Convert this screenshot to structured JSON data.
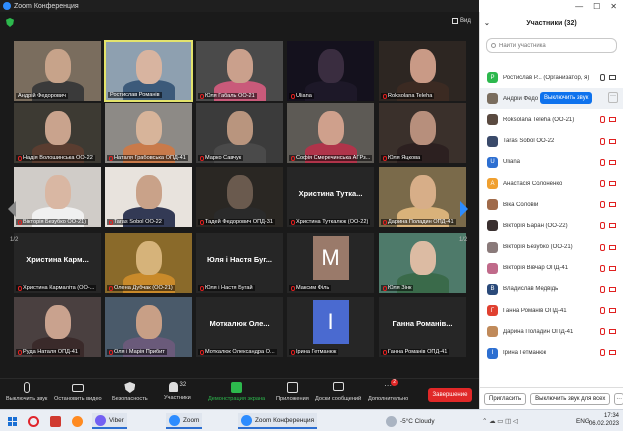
{
  "window": {
    "title": "Zoom Конференция",
    "minimize_glyph": "—",
    "maximize_glyph": "☐",
    "close_glyph": "✕"
  },
  "meeting": {
    "view_label": "Вид",
    "page_left": "1/2",
    "page_right": "1/2",
    "tiles": [
      {
        "name": "Андрій Федорович",
        "mic_off": false,
        "kind": "video",
        "face": "#c7a38a",
        "shirt": "#3a3a3a",
        "bg": "#7a6d5e"
      },
      {
        "name": "Ростислав Романів",
        "mic_off": false,
        "kind": "video",
        "face": "#d8b4a0",
        "shirt": "#3c5a7a",
        "bg": "#8ea0b0",
        "active": true
      },
      {
        "name": "Юля Габаль ОО-21",
        "mic_off": true,
        "kind": "video",
        "face": "#caa08c",
        "shirt": "#c95a7a",
        "bg": "#4a4a4a"
      },
      {
        "name": "Uliana",
        "mic_off": true,
        "kind": "video",
        "face": "#3a2d40",
        "shirt": "#1d1828",
        "bg": "#14111d"
      },
      {
        "name": "Roksolana Teleha",
        "mic_off": true,
        "kind": "video",
        "face": "#c99a86",
        "shirt": "#3b2a22",
        "bg": "#2d2622"
      },
      {
        "name": "Надія Волошинська ОО-22",
        "mic_off": true,
        "kind": "video",
        "face": "#c9a38d",
        "shirt": "#5a3d30",
        "bg": "#3d3a33"
      },
      {
        "name": "Наталя Грабовська ОПД-41",
        "mic_off": true,
        "kind": "video",
        "face": "#d7b49a",
        "shirt": "#c97a4a",
        "bg": "#8d8a86"
      },
      {
        "name": "Марко Савчук",
        "mic_off": true,
        "kind": "video",
        "face": "#b9957e",
        "shirt": "#4a4a4a",
        "bg": "#3b3b3b"
      },
      {
        "name": "Софія Смеречинська АГРз...",
        "mic_off": true,
        "kind": "video",
        "face": "#cfa08c",
        "shirt": "#b0344a",
        "bg": "#5d5a55"
      },
      {
        "name": "Юля Яцкова",
        "mic_off": true,
        "kind": "video",
        "face": "#b78f7c",
        "shirt": "#2c2020",
        "bg": "#3a302b"
      },
      {
        "name": "Вікторія Безубко ОО-21)",
        "mic_off": true,
        "kind": "video",
        "face": "#d9b7a3",
        "shirt": "#f0f0f0",
        "bg": "#d0ccc8"
      },
      {
        "name": "Taras Sobol OO-22",
        "mic_off": true,
        "kind": "video",
        "face": "#c9a289",
        "shirt": "#333a55",
        "bg": "#e8e3dd"
      },
      {
        "name": "Тадей Федорович ОПД-31",
        "mic_off": true,
        "kind": "video",
        "face": "#6a5a4e",
        "shirt": "#2a2a2a",
        "bg": "#2a2723"
      },
      {
        "name": "Христина Туткалюк (ОО-22)",
        "mic_off": true,
        "kind": "name",
        "big": "Христина  Тутка..."
      },
      {
        "name": "Дарина Поладин ОПД-41",
        "mic_off": true,
        "kind": "video",
        "face": "#d7ae88",
        "shirt": "#d9b27a",
        "bg": "#7a6a4a"
      },
      {
        "name": "Христина Кармаліта (ОО-...",
        "mic_off": true,
        "kind": "name",
        "big": "Христина  Карм..."
      },
      {
        "name": "Олена Дубчак (ОО-21)",
        "mic_off": true,
        "kind": "video",
        "face": "#d6b37a",
        "shirt": "#c98a2a",
        "bg": "#8a6a2a"
      },
      {
        "name": "Юля і Настя Бугай",
        "mic_off": true,
        "kind": "name",
        "big": "Юля і Настя Буг..."
      },
      {
        "name": "Максим Філь",
        "mic_off": true,
        "kind": "letter",
        "letter": "M",
        "color": "#9a7a6a"
      },
      {
        "name": "Юля Зінк",
        "mic_off": true,
        "kind": "video",
        "face": "#dcbba3",
        "shirt": "#3a6a4a",
        "bg": "#4e7a6a"
      },
      {
        "name": "Руда Наталя ОПД-41",
        "mic_off": true,
        "kind": "video",
        "face": "#c9a28e",
        "shirt": "#3a2a2a",
        "bg": "#4a4040"
      },
      {
        "name": "Оля і Марія Прибит",
        "mic_off": true,
        "kind": "video",
        "face": "#c89f86",
        "shirt": "#6a5a7a",
        "bg": "#4a5a6a"
      },
      {
        "name": "Моткалюк Олександра О...",
        "mic_off": true,
        "kind": "name",
        "big": "Моткалюк  Оле..."
      },
      {
        "name": "Ірина Гетманюк",
        "mic_off": true,
        "kind": "letter",
        "letter": "I",
        "color": "#4a6ad0"
      },
      {
        "name": "Ганна Романів ОПД-41",
        "mic_off": true,
        "kind": "name",
        "big": "Ганна  Романів..."
      }
    ]
  },
  "toolbar": {
    "mute_label": "Выключить звук",
    "video_label": "Остановить видео",
    "security_label": "Безопасность",
    "participants_label": "Участники",
    "participants_count": "32",
    "share_label": "Демонстрация экрана",
    "apps_label": "Приложения",
    "whiteboard_label": "Доски сообщений",
    "more_label": "Дополнительно",
    "more_badge": "2",
    "end_label": "Завершение",
    "chevron": "^"
  },
  "participants": {
    "title": "Участники (32)",
    "search_placeholder": "Найти участника",
    "unmute_button": "Выключить звук",
    "more_button": "···",
    "list": [
      {
        "initial": "Р",
        "name": "Ростислав Р... (Организатор, я)",
        "color": "#2db84d",
        "mic": "on",
        "cam": "on"
      },
      {
        "initial": "",
        "name": "Андрій Федо",
        "color": "#7a6d5e",
        "host_row": true
      },
      {
        "initial": "",
        "name": "Roksolana Teleha (ОО-21)",
        "color": "#5a4a40",
        "mic": "off",
        "cam": "off"
      },
      {
        "initial": "",
        "name": "Taras Sobol OO-22",
        "color": "#3a4a6a",
        "mic": "off",
        "cam": "off"
      },
      {
        "initial": "U",
        "name": "Uliana",
        "color": "#2d6fd1",
        "mic": "off",
        "cam": "off"
      },
      {
        "initial": "A",
        "name": "Анастасія Солоненко",
        "color": "#f0a030",
        "mic": "off",
        "cam": "off"
      },
      {
        "initial": "",
        "name": "Віка Соловій",
        "color": "#a06a4a",
        "mic": "off",
        "cam": "off"
      },
      {
        "initial": "",
        "name": "Вікторія Баран (ОО-22)",
        "color": "#3a3030",
        "mic": "off",
        "cam": "off"
      },
      {
        "initial": "",
        "name": "Вікторія Безубко (ОО-21)",
        "color": "#8a7a7a",
        "mic": "off",
        "cam": "off"
      },
      {
        "initial": "",
        "name": "Вікторія Вівчар ОПД-41",
        "color": "#c06a8a",
        "mic": "off",
        "cam": "off"
      },
      {
        "initial": "B",
        "name": "Владислав Медвідь",
        "color": "#2a4a7a",
        "mic": "off",
        "cam": "off"
      },
      {
        "initial": "Г",
        "name": "Ганна Романів ОПД-41",
        "color": "#e04030",
        "mic": "off",
        "cam": "off"
      },
      {
        "initial": "",
        "name": "Дарина Поладин ОПД-41",
        "color": "#c08a5a",
        "mic": "off",
        "cam": "off"
      },
      {
        "initial": "I",
        "name": "Ірина Гетманюк",
        "color": "#2d6fd1",
        "mic": "off",
        "cam": "off"
      }
    ],
    "invite_button": "Пригласить",
    "mute_all_button": "Выключить звук для всех"
  },
  "taskbar": {
    "viber_label": "Viber",
    "zoom_label": "Zoom",
    "zoom_conf_label": "Zoom Конференция",
    "weather": "-5°C  Cloudy",
    "lang": "ENG",
    "time": "17:34",
    "date": "06.02.2023"
  }
}
